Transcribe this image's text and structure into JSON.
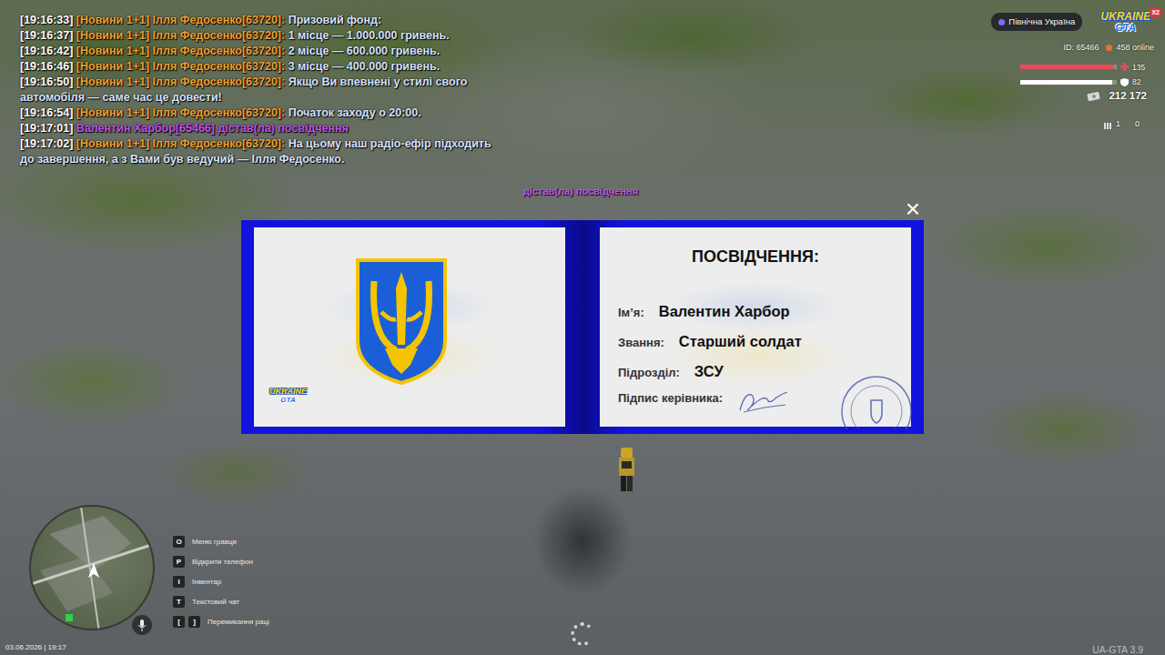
{
  "chat": [
    {
      "time": "[19:16:33]",
      "author": "[Новини 1+1] Ілля Федосенко[63720]:",
      "text": "Призовий фонд:",
      "kind": "news",
      "color": "#f0a030"
    },
    {
      "time": "[19:16:37]",
      "author": "[Новини 1+1] Ілля Федосенко[63720]:",
      "text": "1 місце — 1.000.000 гривень.",
      "kind": "news",
      "color": "#f0a030"
    },
    {
      "time": "[19:16:42]",
      "author": "[Новини 1+1] Ілля Федосенко[63720]:",
      "text": "2 місце — 600.000 гривень.",
      "kind": "news",
      "color": "#f0a030"
    },
    {
      "time": "[19:16:46]",
      "author": "[Новини 1+1] Ілля Федосенко[63720]:",
      "text": "3 місце — 400.000 гривень.",
      "kind": "news",
      "color": "#f0a030"
    },
    {
      "time": "[19:16:50]",
      "author": "[Новини 1+1] Ілля Федосенко[63720]:",
      "text": "Якщо Ви впевнені у стилі свого автомобіля — саме час це довести!",
      "kind": "news",
      "color": "#f0a030"
    },
    {
      "time": "[19:16:54]",
      "author": "[Новини 1+1] Ілля Федосенко[63720]:",
      "text": "Початок заходу о 20:00.",
      "kind": "news",
      "color": "#f0a030"
    },
    {
      "time": "[19:17:01]",
      "author": "",
      "text": "Валентин Харбор[65466] дістав(ла) посвідчення",
      "kind": "action",
      "color": "#c153e8"
    },
    {
      "time": "[19:17:02]",
      "author": "[Новини 1+1] Ілля Федосенко[63720]:",
      "text": "На цьому наш радіо-ефір підходить до завершення, а з Вами був ведучий — Ілля Федосенко.",
      "kind": "news",
      "color": "#f0a030"
    }
  ],
  "floating_text": "дістав(ла) посвідчення",
  "hud": {
    "server": "Північна Україна",
    "logo": {
      "top": "UKRAINE",
      "bottom": "GTA",
      "badge": "X2"
    },
    "player_id": "ID: 65466",
    "online": "458 online",
    "health": {
      "value": "135",
      "level": 0.97
    },
    "armor": {
      "value": "82",
      "level": 0.95
    },
    "money": "212 172",
    "ammo": {
      "clip": "1",
      "total": "0"
    }
  },
  "card": {
    "close": "×",
    "logo": {
      "top": "UKRAINE",
      "bottom": "GTA"
    },
    "title": "ПОСВІДЧЕННЯ:",
    "fields": [
      {
        "label": "Ім’я:",
        "value": "Валентин Харбор"
      },
      {
        "label": "Звання:",
        "value": "Старший солдат"
      },
      {
        "label": "Підрозділ:",
        "value": "ЗСУ"
      }
    ],
    "signature_label": "Підпис керівника:"
  },
  "hints": [
    {
      "keys": [
        "O"
      ],
      "label": "Меню гравця"
    },
    {
      "keys": [
        "P"
      ],
      "label": "Відкрити телефон"
    },
    {
      "keys": [
        "I"
      ],
      "label": "Інвентар"
    },
    {
      "keys": [
        "T"
      ],
      "label": "Текстовий чат"
    },
    {
      "keys": [
        "[",
        "]"
      ],
      "label": "Перемикання раці"
    }
  ],
  "datetime": "03.06.2026 | 19:17",
  "version": "UA-GTA 3.9"
}
